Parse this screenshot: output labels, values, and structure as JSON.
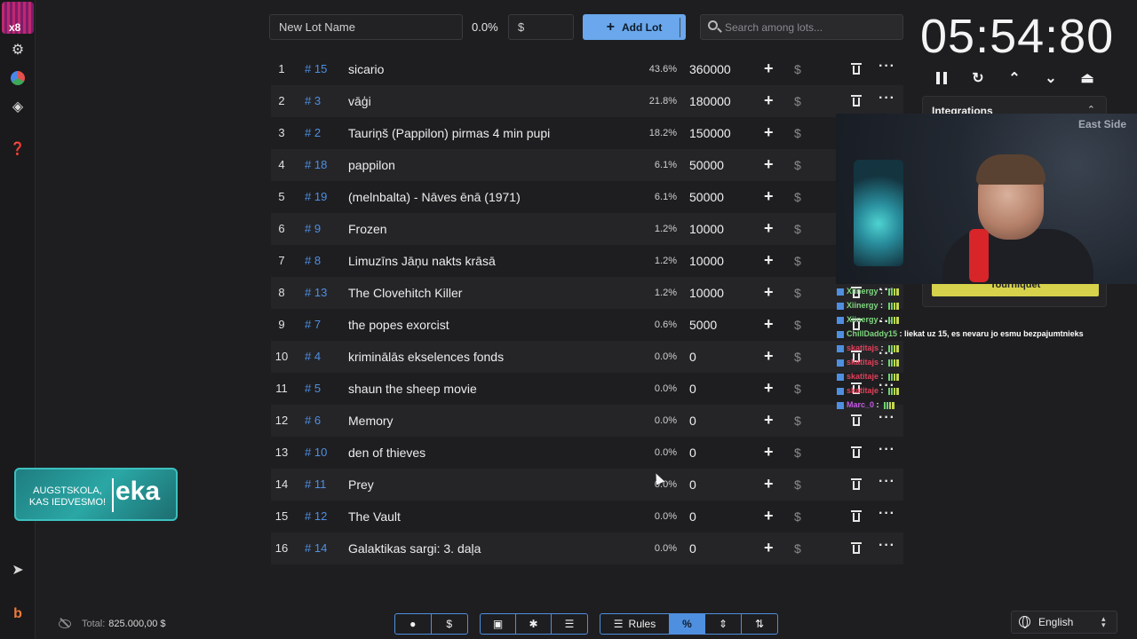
{
  "app": {
    "logo_text": "x8"
  },
  "badge": {
    "small": "AUGSTSKOLA, KAS IEDVESMO!",
    "big": "eka"
  },
  "toolbar": {
    "lot_name_placeholder": "New Lot Name",
    "percent": "0.0%",
    "amount_placeholder": "$",
    "add_lot_label": "Add Lot",
    "search_placeholder": "Search among lots..."
  },
  "lots": [
    {
      "idx": "1",
      "id": "# 15",
      "name": "sicario",
      "pct": "43.6%",
      "amount": "360000"
    },
    {
      "idx": "2",
      "id": "# 3",
      "name": "vāģi",
      "pct": "21.8%",
      "amount": "180000"
    },
    {
      "idx": "3",
      "id": "# 2",
      "name": "Tauriņš (Pappilon) pirmas 4 min pupi",
      "pct": "18.2%",
      "amount": "150000"
    },
    {
      "idx": "4",
      "id": "# 18",
      "name": "pappilon",
      "pct": "6.1%",
      "amount": "50000"
    },
    {
      "idx": "5",
      "id": "# 19",
      "name": "(melnbalta) - Nāves ēnā (1971)",
      "pct": "6.1%",
      "amount": "50000"
    },
    {
      "idx": "6",
      "id": "# 9",
      "name": "Frozen",
      "pct": "1.2%",
      "amount": "10000"
    },
    {
      "idx": "7",
      "id": "# 8",
      "name": "Limuzīns Jāņu nakts krāsā",
      "pct": "1.2%",
      "amount": "10000"
    },
    {
      "idx": "8",
      "id": "# 13",
      "name": "The Clovehitch Killer",
      "pct": "1.2%",
      "amount": "10000"
    },
    {
      "idx": "9",
      "id": "# 7",
      "name": "the popes exorcist",
      "pct": "0.6%",
      "amount": "5000"
    },
    {
      "idx": "10",
      "id": "# 4",
      "name": "kriminālās ekselences fonds",
      "pct": "0.0%",
      "amount": "0"
    },
    {
      "idx": "11",
      "id": "# 5",
      "name": "shaun the sheep movie",
      "pct": "0.0%",
      "amount": "0"
    },
    {
      "idx": "12",
      "id": "# 6",
      "name": "Memory",
      "pct": "0.0%",
      "amount": "0"
    },
    {
      "idx": "13",
      "id": "# 10",
      "name": "den of thieves",
      "pct": "0.0%",
      "amount": "0"
    },
    {
      "idx": "14",
      "id": "# 11",
      "name": "Prey",
      "pct": "0.0%",
      "amount": "0"
    },
    {
      "idx": "15",
      "id": "# 12",
      "name": "The Vault",
      "pct": "0.0%",
      "amount": "0"
    },
    {
      "idx": "16",
      "id": "# 14",
      "name": "Galaktikas sargi: 3. daļa",
      "pct": "0.0%",
      "amount": "0"
    }
  ],
  "row_symbols": {
    "plus": "+",
    "dollar": "$",
    "more": "···"
  },
  "timer": {
    "value": "05:54:80"
  },
  "integrations": {
    "title": "Integrations",
    "tournament_label": "Tourniquet"
  },
  "webcam": {
    "sign_text": "East Side"
  },
  "chat": [
    {
      "user": "Xiinergy",
      "message": "",
      "color": "#7fd67f"
    },
    {
      "user": "Xiinergy",
      "message": "",
      "color": "#7fd67f"
    },
    {
      "user": "Xiinergy",
      "message": "",
      "color": "#7fd67f"
    },
    {
      "user": "ChillDaddy15",
      "message": "liekat uz 15, es nevaru jo esmu bezpajumtnieks",
      "color": "#7fd67f"
    },
    {
      "user": "skatitajs",
      "message": "",
      "color": "#e0405a"
    },
    {
      "user": "skatitajs",
      "message": "",
      "color": "#e0405a"
    },
    {
      "user": "skatitaje",
      "message": "",
      "color": "#e0405a"
    },
    {
      "user": "skatitaje",
      "message": "",
      "color": "#e0405a"
    },
    {
      "user": "Marc_0",
      "message": "",
      "color": "#c25ae0"
    }
  ],
  "footer": {
    "total_label": "Total:",
    "total_value": "825.000,00 $",
    "rules_label": "Rules",
    "percent_symbol": "%",
    "dollar_symbol": "$",
    "language": "English"
  },
  "colors": {
    "accent": "#4f8fe0",
    "add_button": "#6aa7ec",
    "background": "#1e1e20",
    "row_alt": "#252528"
  }
}
